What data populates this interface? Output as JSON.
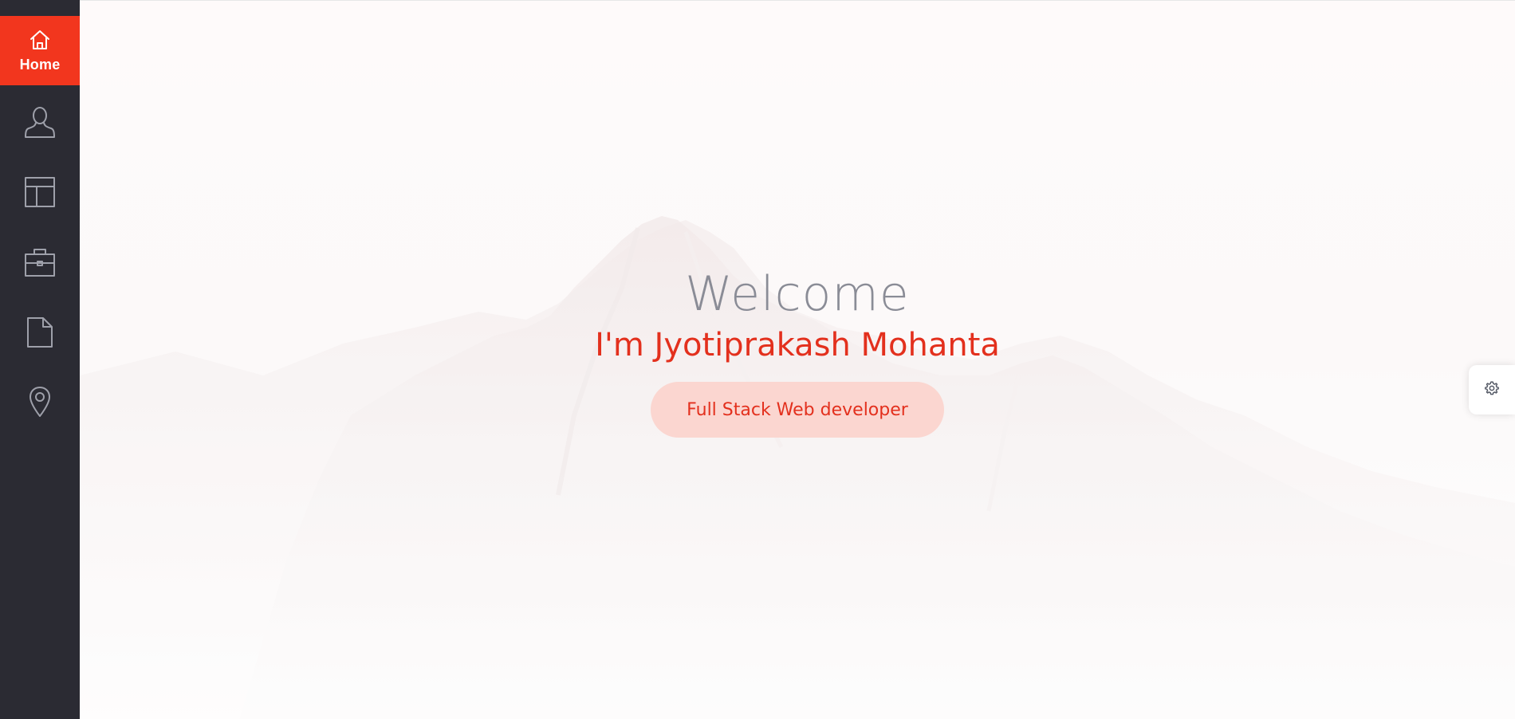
{
  "sidebar": {
    "items": [
      {
        "label": "Home",
        "icon": "home-icon",
        "active": true
      },
      {
        "label": "",
        "icon": "user-icon",
        "active": false
      },
      {
        "label": "",
        "icon": "layout-icon",
        "active": false
      },
      {
        "label": "",
        "icon": "briefcase-icon",
        "active": false
      },
      {
        "label": "",
        "icon": "document-icon",
        "active": false
      },
      {
        "label": "",
        "icon": "map-pin-icon",
        "active": false
      }
    ]
  },
  "hero": {
    "welcome": "Welcome",
    "name": "I'm Jyotiprakash Mohanta",
    "role": "Full Stack Web developer"
  },
  "settings": {
    "icon": "gear-icon"
  },
  "colors": {
    "sidebar_bg": "#2b2b33",
    "accent": "#f2361e",
    "pill_bg": "#fbd6d0",
    "welcome_text": "#8a8c96"
  }
}
